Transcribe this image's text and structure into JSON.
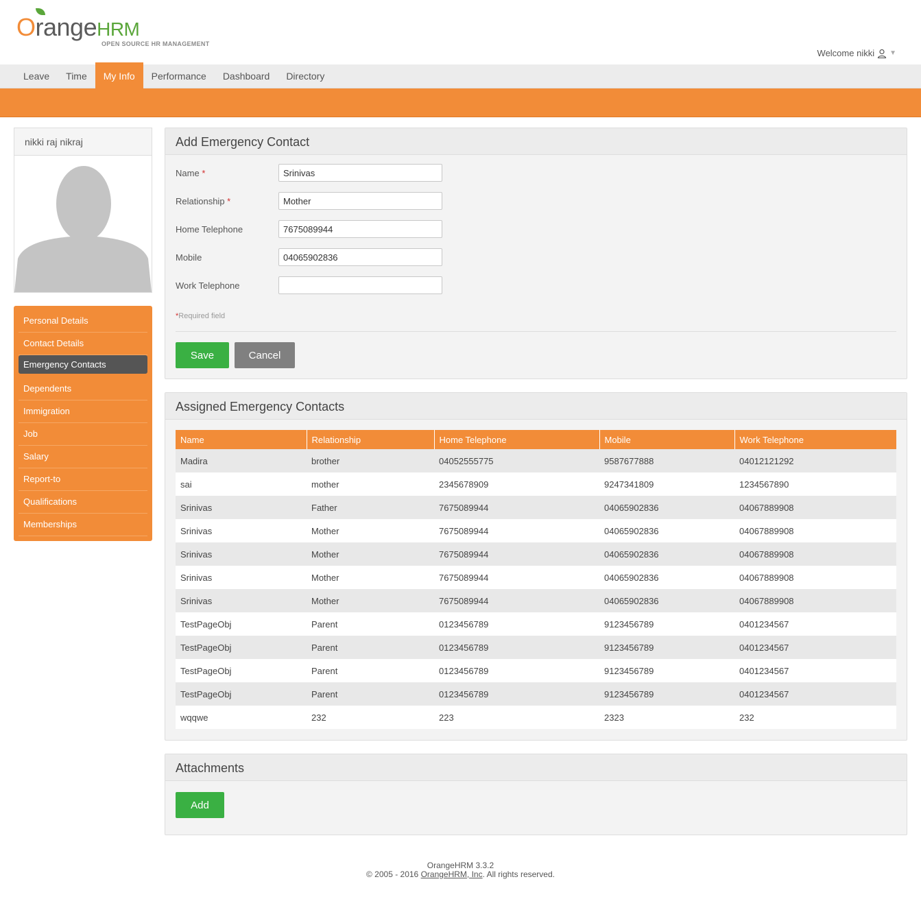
{
  "brand": {
    "logo_word_prefix": "O",
    "logo_word_rest": "range",
    "logo_word_suffix": "HRM",
    "tagline": "OPEN SOURCE HR MANAGEMENT",
    "accent_color": "#f28c38",
    "green_color": "#5aa63a"
  },
  "header": {
    "welcome": "Welcome nikki"
  },
  "nav": {
    "items": [
      "Leave",
      "Time",
      "My Info",
      "Performance",
      "Dashboard",
      "Directory"
    ],
    "active": "My Info"
  },
  "profile": {
    "name": "nikki raj nikraj"
  },
  "side_menu": {
    "items": [
      "Personal Details",
      "Contact Details",
      "Emergency Contacts",
      "Dependents",
      "Immigration",
      "Job",
      "Salary",
      "Report-to",
      "Qualifications",
      "Memberships"
    ],
    "active": "Emergency Contacts"
  },
  "add_contact": {
    "title": "Add Emergency Contact",
    "fields": [
      {
        "label": "Name",
        "required": true,
        "value": "Srinivas"
      },
      {
        "label": "Relationship",
        "required": true,
        "value": "Mother"
      },
      {
        "label": "Home Telephone",
        "required": false,
        "value": "7675089944"
      },
      {
        "label": "Mobile",
        "required": false,
        "value": "04065902836"
      },
      {
        "label": "Work Telephone",
        "required": false,
        "value": ""
      }
    ],
    "required_marker": "*",
    "required_note": "Required field",
    "save_label": "Save",
    "cancel_label": "Cancel"
  },
  "assigned": {
    "title": "Assigned Emergency Contacts",
    "columns": [
      "Name",
      "Relationship",
      "Home Telephone",
      "Mobile",
      "Work Telephone"
    ],
    "rows": [
      [
        "Madira",
        "brother",
        "04052555775",
        "9587677888",
        "04012121292"
      ],
      [
        "sai",
        "mother",
        "2345678909",
        "9247341809",
        "1234567890"
      ],
      [
        "Srinivas",
        "Father",
        "7675089944",
        "04065902836",
        "04067889908"
      ],
      [
        "Srinivas",
        "Mother",
        "7675089944",
        "04065902836",
        "04067889908"
      ],
      [
        "Srinivas",
        "Mother",
        "7675089944",
        "04065902836",
        "04067889908"
      ],
      [
        "Srinivas",
        "Mother",
        "7675089944",
        "04065902836",
        "04067889908"
      ],
      [
        "Srinivas",
        "Mother",
        "7675089944",
        "04065902836",
        "04067889908"
      ],
      [
        "TestPageObj",
        "Parent",
        "0123456789",
        "9123456789",
        "0401234567"
      ],
      [
        "TestPageObj",
        "Parent",
        "0123456789",
        "9123456789",
        "0401234567"
      ],
      [
        "TestPageObj",
        "Parent",
        "0123456789",
        "9123456789",
        "0401234567"
      ],
      [
        "TestPageObj",
        "Parent",
        "0123456789",
        "9123456789",
        "0401234567"
      ],
      [
        "wqqwe",
        "232",
        "223",
        "2323",
        "232"
      ]
    ]
  },
  "attachments": {
    "title": "Attachments",
    "add_label": "Add"
  },
  "footer": {
    "version": "OrangeHRM 3.3.2",
    "copyright_prefix": "© 2005 - 2016 ",
    "company_link": "OrangeHRM, Inc",
    "copyright_suffix": ". All rights reserved."
  }
}
